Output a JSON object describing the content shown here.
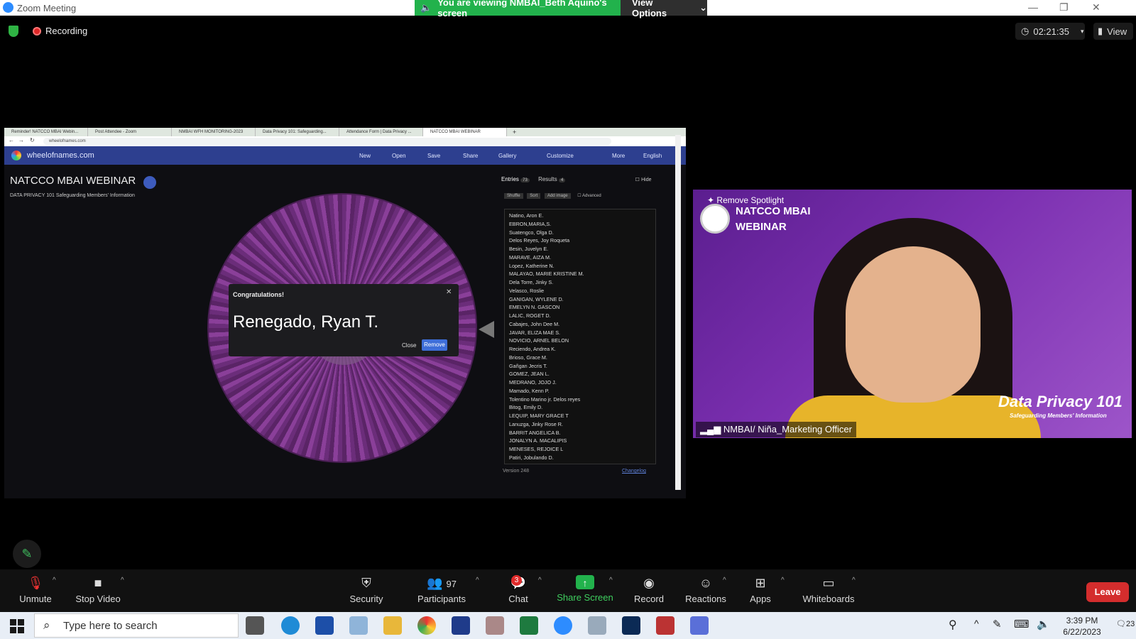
{
  "window": {
    "title": "Zoom Meeting",
    "viewing_banner": "You are viewing NMBAI_Beth Aquino's screen",
    "view_options": "View Options"
  },
  "topbar": {
    "recording": "Recording",
    "timer": "02:21:35",
    "view": "View"
  },
  "browser": {
    "tabs": [
      "Reminder! NATCCO MBAI Webin...",
      "Post Attendee - Zoom",
      "NMBAI WFH MONITORING-2023",
      "Data Privacy 101: Safeguarding...",
      "Attendance Form | Data Privacy ...",
      "NATCCO MBAI WEBINAR"
    ],
    "url": "wheelofnames.com"
  },
  "wheel_site": {
    "site": "wheelofnames.com",
    "nav": [
      "New",
      "Open",
      "Save",
      "Share",
      "Gallery",
      "Customize",
      "More",
      "English"
    ],
    "title": "NATCCO MBAI WEBINAR",
    "subtitle": "DATA PRIVACY 101 Safeguarding Members' Information",
    "dialog": {
      "title": "Congratulations!",
      "winner": "Renegado, Ryan T.",
      "close": "Close",
      "remove": "Remove"
    },
    "tabs": {
      "entries": "Entries",
      "entries_count": "73",
      "results": "Results",
      "results_count": "4",
      "hide": "Hide"
    },
    "toolbar": {
      "shuffle": "Shuffle",
      "sort": "Sort",
      "add_image": "Add image",
      "advanced": "Advanced"
    },
    "entries": [
      "Natino, Aron E.",
      "EBRON,MARIA,S.",
      "Suatengco, Olga D.",
      "Delos Reyes, Joy Roqueta",
      "Besin, Juvelyn E.",
      "MARAVE, AIZA M.",
      "Lopez, Katherine N.",
      "MALAYAO, MARIE KRISTINE M.",
      "Dela Torre, Jinky S.",
      "Velasco, Roslie",
      "GANIGAN, WYLENE D.",
      "EMELYN N. GASCON",
      "LALIC, ROGET D.",
      "Cabajes, John Dee M.",
      "JAVAR, ELIZA MAE S.",
      "NOVICIO, ARNEL BELON",
      "Reciendo, Andrea K.",
      "Brioso, Grace M.",
      "Gañgan Jecris T.",
      "GOMEZ, JEAN L.",
      "MEDRANO, JOJO J.",
      "Mamado, Kenn P.",
      "Tolentino Marino jr. Delos reyes",
      "Bitog, Emily D.",
      "LEQUIP, MARY GRACE T",
      "Lanuzga, Jinky Rose R.",
      "BARRIT ANGELICA B.",
      "JONALYN A. MACALIPIS",
      "MENESES, REJOICE L",
      "Patiri, Jobulando D."
    ],
    "version": "Version 248",
    "changelog": "Changelog"
  },
  "video": {
    "remove_spotlight": "Remove Spotlight",
    "brand_line1": "NATCCO MBAI",
    "brand_line2": "WEBINAR",
    "data_privacy": "Data Privacy 101",
    "data_privacy_sub": "Safeguarding Members' Information",
    "participant_name": "NMBAI/ Niña_Marketing Officer"
  },
  "toolbar": {
    "unmute": "Unmute",
    "stop_video": "Stop Video",
    "security": "Security",
    "participants": "Participants",
    "participants_count": "97",
    "chat": "Chat",
    "chat_badge": "3",
    "share_screen": "Share Screen",
    "record": "Record",
    "reactions": "Reactions",
    "apps": "Apps",
    "whiteboards": "Whiteboards",
    "leave": "Leave"
  },
  "taskbar": {
    "search_placeholder": "Type here to search",
    "time": "3:39 PM",
    "date": "6/22/2023",
    "notifications": "23"
  },
  "colors": {
    "zoom_blue": "#2d8cff",
    "banner_green": "#22b24c",
    "leave_red": "#d42d2d",
    "wheel_nav": "#2d3f8f",
    "remove_btn": "#3e6ed9"
  }
}
